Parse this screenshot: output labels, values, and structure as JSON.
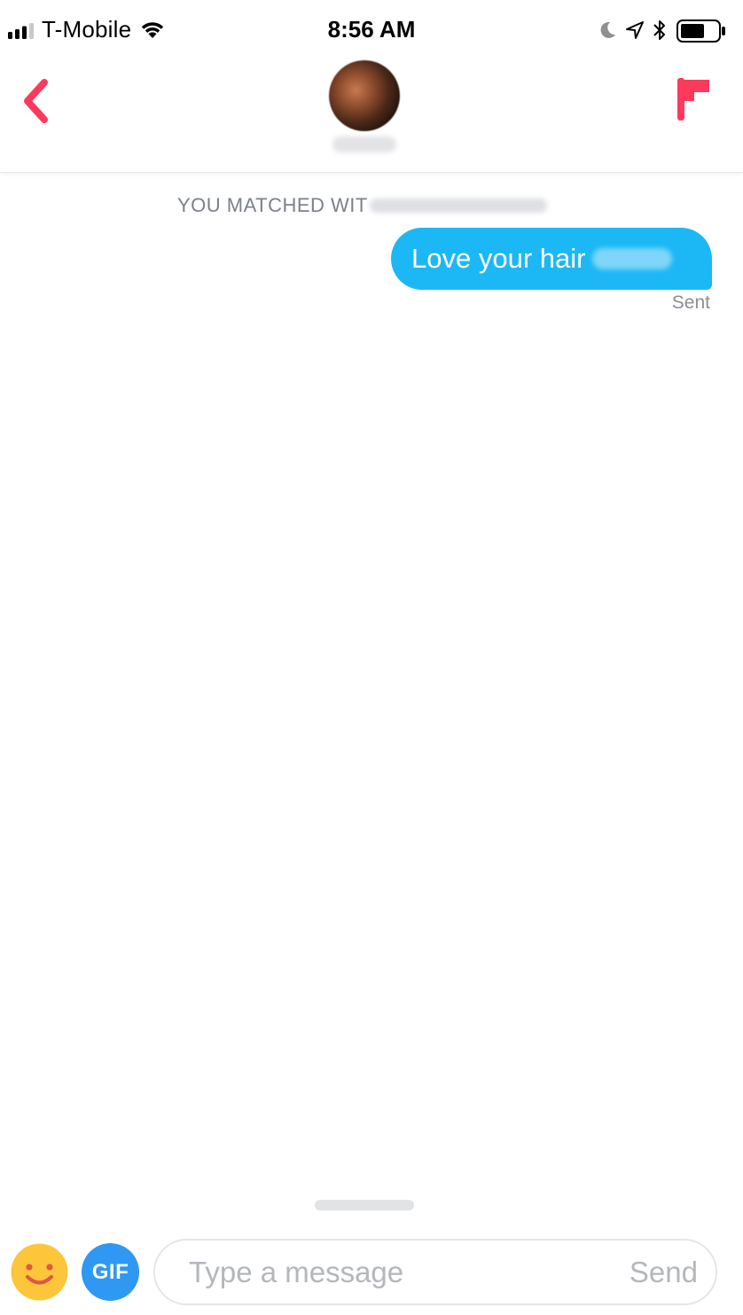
{
  "status_bar": {
    "carrier": "T-Mobile",
    "time": "8:56 AM",
    "icons": [
      "signal-icon",
      "wifi-icon",
      "moon-icon",
      "location-arrow-icon",
      "bluetooth-icon",
      "battery-icon"
    ],
    "battery_level": 0.6
  },
  "header": {
    "back_icon": "chevron-left-icon",
    "flag_icon": "flag-icon",
    "accent_color": "#fd3a5c"
  },
  "chat": {
    "matched_prefix": "YOU MATCHED WIT",
    "messages": [
      {
        "text": "Love your hair",
        "status": "Sent",
        "color": "#1cb8f5"
      }
    ]
  },
  "composer": {
    "emoji_icon": "smiley-emoji-icon",
    "gif_label": "GIF",
    "placeholder": "Type a message",
    "send_label": "Send"
  }
}
